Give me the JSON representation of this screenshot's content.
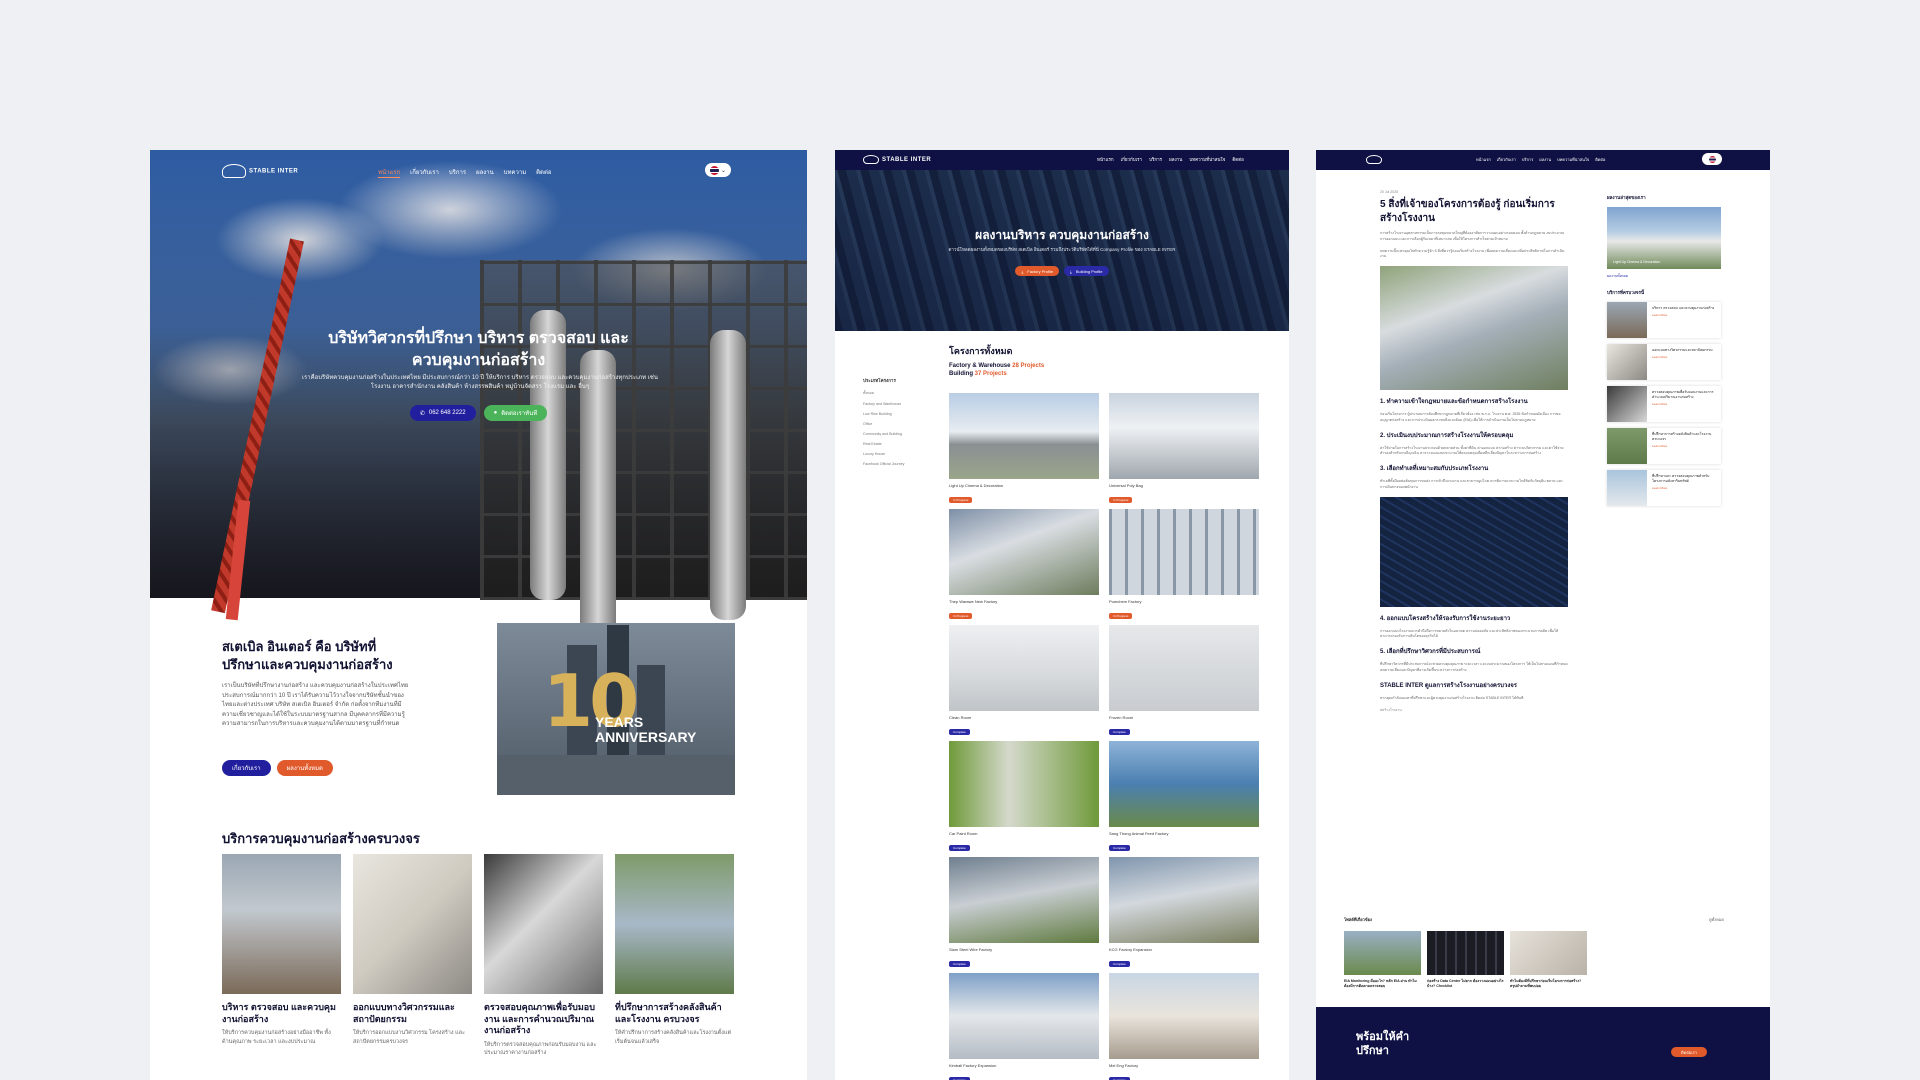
{
  "panel1": {
    "nav": {
      "logo": "STABLE INTER",
      "items": [
        "หน้าแรก",
        "เกี่ยวกับเรา",
        "บริการ",
        "ผลงาน",
        "บทความ",
        "ติดต่อ"
      ]
    },
    "hero": {
      "title_line1": "บริษัทวิศวกรที่ปรึกษา บริหาร ตรวจสอบ และ",
      "title_line2": "ควบคุมงานก่อสร้าง",
      "subtitle": "เราคือบริษัทควบคุมงานก่อสร้างในประเทศไทย มีประสบการณ์กว่า 10 ปี ให้บริการ บริหาร ตรวจสอบ และควบคุมงานก่อสร้างทุกประเภท เช่น โรงงาน อาคารสำนักงาน คลังสินค้า ห้างสรรพสินค้า หมู่บ้านจัดสรร โรงแรม และ อื่นๆ",
      "phone": "062 648 2222",
      "contact_btn": "ติดต่อเราทันที"
    },
    "about": {
      "heading_line1": "สเตเบิล อินเตอร์ คือ บริษัทที่",
      "heading_line2": "ปรึกษาและควบคุมงานก่อสร้าง",
      "text": "เราเป็นบริษัทที่ปรึกษางานก่อสร้าง และควบคุมงานก่อสร้างในประเทศไทย ประสบการณ์มากกว่า 10 ปี เราได้รับความไว้วางใจจากบริษัทชั้นนำของไทยและต่างประเทศ บริษัท สเตเบิล อินเตอร์ จำกัด ก่อตั้งจากทีมงานที่มีความเชี่ยวชาญและได้ใช้ในระบบมาตรฐานสากล มีบุคคลากรที่มีความรู้ความสามารถในการบริหารและควบคุมงานได้ตามมาตรฐานที่กำหนด",
      "btn_about": "เกี่ยวกับเรา",
      "btn_projects": "ผลงานทั้งหมด",
      "anni_number": "10",
      "anni_text_line1": "YEARS",
      "anni_text_line2": "ANNIVERSARY"
    },
    "services": {
      "heading": "บริการควบคุมงานก่อสร้างครบวงจร",
      "items": [
        {
          "title": "บริหาร ตรวจสอบ และควบคุมงานก่อสร้าง",
          "desc": "ให้บริการควบคุมงานก่อสร้างอย่างมืออาชีพ ทั้งด้านคุณภาพ ระยะเวลา และงบประมาณ"
        },
        {
          "title": "ออกแบบทางวิศวกรรมและสถาปัตยกรรม",
          "desc": "ให้บริการออกแบบงานวิศวกรรม โครงสร้าง และสถาปัตยกรรมครบวงจร"
        },
        {
          "title": "ตรวจสอบคุณภาพเพื่อรับมอบงาน และการคำนวณปริมาณงานก่อสร้าง",
          "desc": "ให้บริการตรวจสอบคุณภาพก่อนรับมอบงาน และประมาณราคางานก่อสร้าง"
        },
        {
          "title": "ที่ปรึกษาการสร้างคลังสินค้าและโรงงาน ครบวงจร",
          "desc": "ให้คำปรึกษาการสร้างคลังสินค้าและโรงงานตั้งแต่เริ่มต้นจนแล้วเสร็จ"
        }
      ]
    }
  },
  "panel2": {
    "nav": {
      "logo": "STABLE INTER",
      "items": [
        "หน้าแรก",
        "เกี่ยวกับเรา",
        "บริการ",
        "ผลงาน",
        "บทความที่น่าสนใจ",
        "ติดต่อ"
      ]
    },
    "hero": {
      "title": "ผลงานบริหาร ควบคุมงานก่อสร้าง",
      "subtitle": "ดาวน์โหลดผลงานทั้งหมดของบริษัท สเตเบิล อินเตอร์ รวมถึงประวัติบริษัทได้ที่นี่ Company Profile ของ STABLE INTER",
      "btn1": "Factory Profile",
      "btn2": "Building Profile"
    },
    "projects": {
      "heading": "โครงการทั้งหมด",
      "line1_label": "Factory & Warehouse",
      "line1_count": "28 Projects",
      "line2_label": "Building",
      "line2_count": "37 Projects"
    },
    "categories": {
      "heading": "ประเภทโครงการ",
      "items": [
        "ทั้งหมด",
        "Factory and Warehouse",
        "Low Rise Building",
        "Office",
        "Community and Building",
        "Real Estate",
        "Luxury House",
        "Facebook Official Journey"
      ]
    },
    "grid": [
      {
        "name": "Light Up Cinema & Decoration",
        "badge": "In Progress",
        "color": "orange"
      },
      {
        "name": "Universal Poly Bag",
        "badge": "In Progress",
        "color": "orange"
      },
      {
        "name": "Thep Warawe New Factory",
        "badge": "In Progress",
        "color": "orange"
      },
      {
        "name": "Pumchem Factory",
        "badge": "In Progress",
        "color": "orange"
      },
      {
        "name": "Clean Room",
        "badge": "Complete",
        "color": "blue"
      },
      {
        "name": "Frozen Room",
        "badge": "Complete",
        "color": "blue"
      },
      {
        "name": "Car Paint Room",
        "badge": "Complete",
        "color": "blue"
      },
      {
        "name": "Sang Thong Animal Feed Factory",
        "badge": "Complete",
        "color": "blue"
      },
      {
        "name": "Siam Steel Wire Factory",
        "badge": "Complete",
        "color": "blue"
      },
      {
        "name": "KCG Factory Expansion",
        "badge": "Complete",
        "color": "blue"
      },
      {
        "name": "Kimball Factory Expansion",
        "badge": "Complete",
        "color": "blue"
      },
      {
        "name": "Mei Eng Factory",
        "badge": "Complete",
        "color": "blue"
      }
    ]
  },
  "panel3": {
    "nav": {
      "logo": "STABLE INTER",
      "items": [
        "หน้าแรก",
        "เกี่ยวกับเรา",
        "บริการ",
        "ผลงาน",
        "บทความที่น่าสนใจ",
        "ติดต่อ"
      ]
    },
    "article": {
      "date": "20 Jul 2025",
      "title_line1": "5 สิ่งที่เจ้าของโครงการต้องรู้ ก่อนเริ่มการ",
      "title_line2": "สร้างโรงงาน",
      "intro": "การสร้างโรงงานอุตสาหกรรมเป็นการลงทุนขนาดใหญ่ที่ต้องอาศัยการวางแผนอย่างรอบคอบ ทั้งด้านกฎหมาย งบประมาณ การออกแบบ และการเลือกผู้รับเหมาที่เหมาะสม เพื่อให้โครงการสำเร็จตามเป้าหมาย",
      "intro2": "บทความนี้จะพาคุณไปทำความรู้จัก 5 สิ่งที่ควรรู้ก่อนเริ่มสร้างโรงงาน เพื่อลดความเสี่ยงและเพิ่มประสิทธิภาพในการดำเนินงาน",
      "s1_title": "1. ทำความเข้าใจกฎหมายและข้อกำหนดการสร้างโรงงาน",
      "s1_text": "ก่อนเริ่มโครงการ ผู้ประกอบการต้องศึกษากฎหมายที่เกี่ยวข้อง เช่น พ.ร.บ. โรงงาน พ.ศ. 2535 ข้อกำหนดผังเมือง การขออนุญาตก่อสร้าง และการประเมินผลกระทบสิ่งแวดล้อม (EIA) เพื่อให้การดำเนินงานเป็นไปตามกฎหมาย",
      "s2_title": "2. ประเมินงบประมาณการสร้างโรงงานให้ครอบคลุม",
      "s2_text": "ค่าใช้จ่ายในการสร้างโรงงานประกอบด้วยหลายส่วน ทั้งค่าที่ดิน ค่าออกแบบ ค่าก่อสร้าง ค่าระบบวิศวกรรม และค่าใช้จ่ายสำรองสำหรับกรณีฉุกเฉิน ควรวางแผนงบประมาณให้ครอบคลุมเพื่อหลีกเลี่ยงปัญหาในระหว่างการก่อสร้าง",
      "s3_title": "3. เลือกทำเลที่เหมาะสมกับประเภทโรงงาน",
      "s3_text": "ทำเลที่ตั้งมีผลต่อต้นทุนการขนส่ง การเข้าถึงแรงงาน และสาธารณูปโภค ควรพิจารณาความใกล้ชิดกับวัตถุดิบ ตลาด และการเดินทางของพนักงาน",
      "s4_title": "4. ออกแบบโครงสร้างให้รองรับการใช้งานระยะยาว",
      "s4_text": "การออกแบบโรงงานควรคำนึงถึงการขยายตัวในอนาคต ความปลอดภัย และประสิทธิภาพของกระบวนการผลิต เพื่อให้สามารถรองรับการเติบโตของธุรกิจได้",
      "s5_title": "5. เลือกที่ปรึกษาวิศวกรที่มีประสบการณ์",
      "s5_text": "ที่ปรึกษาวิศวกรที่มีประสบการณ์จะช่วยควบคุมคุณภาพ ระยะเวลา และงบประมาณของโครงการ ให้เป็นไปตามแผนที่กำหนด ลดความเสี่ยงและปัญหาที่อาจเกิดขึ้นระหว่างการก่อสร้าง",
      "s6_title": "STABLE INTER ดูแลการสร้างโรงงานอย่างครบวงจร",
      "s6_text": "หากคุณกำลังมองหาที่ปรึกษาและผู้ควบคุมงานก่อสร้างโรงงาน ติดต่อ STABLE INTER ได้ทันที",
      "tag": "#สร้างโรงงาน"
    },
    "sidebar": {
      "h1": "ผลงานล่าสุดของเรา",
      "feat_label": "Light Up Cinema & Decoration",
      "feat_link": "ผลงานทั้งหมด",
      "h2": "บริการที่ครบวงจรนี้",
      "more": "Learn More",
      "items": [
        "บริหาร ตรวจสอบ และควบคุมงานก่อสร้าง",
        "ออกแบบทางวิศวกรรมและสถาปัตยกรรม",
        "ตรวจสอบคุณภาพเพื่อรับมอบงานและการคำนวณปริมาณงานก่อสร้าง",
        "ที่ปรึกษาการสร้างคลังสินค้าและโรงงาน ครบวงจร",
        "ที่ปรึกษาและ ตรวจสอบคุณภาพสำหรับโครงการอสังหาริมทรัพย์"
      ]
    },
    "related": {
      "heading": "โพสต์ที่เกี่ยวข้อง",
      "view_all": "ดูทั้งหมด",
      "cards": [
        "EIA Monitoring คืออะไร? หลัก EIA ผ่าน ทำไมต้องมีการติดตามตรวจสอบ",
        "ก่อสร้าง Data Center ไม่ยาก ต้องวางแผนอย่างไรบ้าง? Checklist",
        "ทำไมต้องมีที่ปรึกษาก่อนเริ่มโครงการก่อสร้าง? สรุปคำถามที่พบบ่อย"
      ]
    },
    "footer": {
      "line1": "พร้อมให้คำ",
      "line2": "ปรึกษา",
      "btn": "ติดต่อเรา"
    }
  }
}
